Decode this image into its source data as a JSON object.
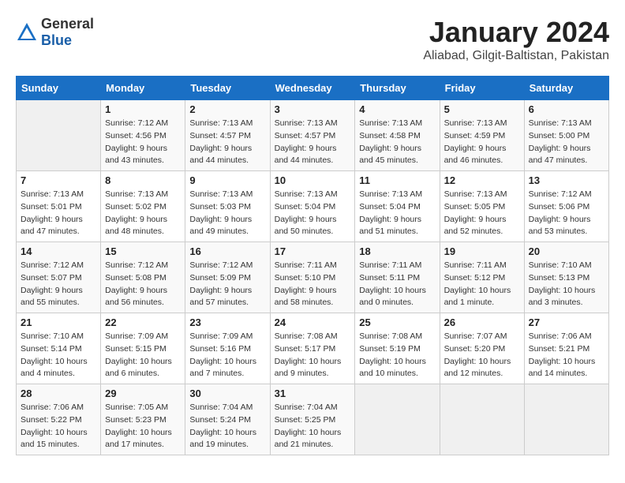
{
  "header": {
    "logo_general": "General",
    "logo_blue": "Blue",
    "title": "January 2024",
    "location": "Aliabad, Gilgit-Baltistan, Pakistan"
  },
  "days_of_week": [
    "Sunday",
    "Monday",
    "Tuesday",
    "Wednesday",
    "Thursday",
    "Friday",
    "Saturday"
  ],
  "weeks": [
    [
      {
        "day": "",
        "sunrise": "",
        "sunset": "",
        "daylight": ""
      },
      {
        "day": "1",
        "sunrise": "Sunrise: 7:12 AM",
        "sunset": "Sunset: 4:56 PM",
        "daylight": "Daylight: 9 hours and 43 minutes."
      },
      {
        "day": "2",
        "sunrise": "Sunrise: 7:13 AM",
        "sunset": "Sunset: 4:57 PM",
        "daylight": "Daylight: 9 hours and 44 minutes."
      },
      {
        "day": "3",
        "sunrise": "Sunrise: 7:13 AM",
        "sunset": "Sunset: 4:57 PM",
        "daylight": "Daylight: 9 hours and 44 minutes."
      },
      {
        "day": "4",
        "sunrise": "Sunrise: 7:13 AM",
        "sunset": "Sunset: 4:58 PM",
        "daylight": "Daylight: 9 hours and 45 minutes."
      },
      {
        "day": "5",
        "sunrise": "Sunrise: 7:13 AM",
        "sunset": "Sunset: 4:59 PM",
        "daylight": "Daylight: 9 hours and 46 minutes."
      },
      {
        "day": "6",
        "sunrise": "Sunrise: 7:13 AM",
        "sunset": "Sunset: 5:00 PM",
        "daylight": "Daylight: 9 hours and 47 minutes."
      }
    ],
    [
      {
        "day": "7",
        "sunrise": "Sunrise: 7:13 AM",
        "sunset": "Sunset: 5:01 PM",
        "daylight": "Daylight: 9 hours and 47 minutes."
      },
      {
        "day": "8",
        "sunrise": "Sunrise: 7:13 AM",
        "sunset": "Sunset: 5:02 PM",
        "daylight": "Daylight: 9 hours and 48 minutes."
      },
      {
        "day": "9",
        "sunrise": "Sunrise: 7:13 AM",
        "sunset": "Sunset: 5:03 PM",
        "daylight": "Daylight: 9 hours and 49 minutes."
      },
      {
        "day": "10",
        "sunrise": "Sunrise: 7:13 AM",
        "sunset": "Sunset: 5:04 PM",
        "daylight": "Daylight: 9 hours and 50 minutes."
      },
      {
        "day": "11",
        "sunrise": "Sunrise: 7:13 AM",
        "sunset": "Sunset: 5:04 PM",
        "daylight": "Daylight: 9 hours and 51 minutes."
      },
      {
        "day": "12",
        "sunrise": "Sunrise: 7:13 AM",
        "sunset": "Sunset: 5:05 PM",
        "daylight": "Daylight: 9 hours and 52 minutes."
      },
      {
        "day": "13",
        "sunrise": "Sunrise: 7:12 AM",
        "sunset": "Sunset: 5:06 PM",
        "daylight": "Daylight: 9 hours and 53 minutes."
      }
    ],
    [
      {
        "day": "14",
        "sunrise": "Sunrise: 7:12 AM",
        "sunset": "Sunset: 5:07 PM",
        "daylight": "Daylight: 9 hours and 55 minutes."
      },
      {
        "day": "15",
        "sunrise": "Sunrise: 7:12 AM",
        "sunset": "Sunset: 5:08 PM",
        "daylight": "Daylight: 9 hours and 56 minutes."
      },
      {
        "day": "16",
        "sunrise": "Sunrise: 7:12 AM",
        "sunset": "Sunset: 5:09 PM",
        "daylight": "Daylight: 9 hours and 57 minutes."
      },
      {
        "day": "17",
        "sunrise": "Sunrise: 7:11 AM",
        "sunset": "Sunset: 5:10 PM",
        "daylight": "Daylight: 9 hours and 58 minutes."
      },
      {
        "day": "18",
        "sunrise": "Sunrise: 7:11 AM",
        "sunset": "Sunset: 5:11 PM",
        "daylight": "Daylight: 10 hours and 0 minutes."
      },
      {
        "day": "19",
        "sunrise": "Sunrise: 7:11 AM",
        "sunset": "Sunset: 5:12 PM",
        "daylight": "Daylight: 10 hours and 1 minute."
      },
      {
        "day": "20",
        "sunrise": "Sunrise: 7:10 AM",
        "sunset": "Sunset: 5:13 PM",
        "daylight": "Daylight: 10 hours and 3 minutes."
      }
    ],
    [
      {
        "day": "21",
        "sunrise": "Sunrise: 7:10 AM",
        "sunset": "Sunset: 5:14 PM",
        "daylight": "Daylight: 10 hours and 4 minutes."
      },
      {
        "day": "22",
        "sunrise": "Sunrise: 7:09 AM",
        "sunset": "Sunset: 5:15 PM",
        "daylight": "Daylight: 10 hours and 6 minutes."
      },
      {
        "day": "23",
        "sunrise": "Sunrise: 7:09 AM",
        "sunset": "Sunset: 5:16 PM",
        "daylight": "Daylight: 10 hours and 7 minutes."
      },
      {
        "day": "24",
        "sunrise": "Sunrise: 7:08 AM",
        "sunset": "Sunset: 5:17 PM",
        "daylight": "Daylight: 10 hours and 9 minutes."
      },
      {
        "day": "25",
        "sunrise": "Sunrise: 7:08 AM",
        "sunset": "Sunset: 5:19 PM",
        "daylight": "Daylight: 10 hours and 10 minutes."
      },
      {
        "day": "26",
        "sunrise": "Sunrise: 7:07 AM",
        "sunset": "Sunset: 5:20 PM",
        "daylight": "Daylight: 10 hours and 12 minutes."
      },
      {
        "day": "27",
        "sunrise": "Sunrise: 7:06 AM",
        "sunset": "Sunset: 5:21 PM",
        "daylight": "Daylight: 10 hours and 14 minutes."
      }
    ],
    [
      {
        "day": "28",
        "sunrise": "Sunrise: 7:06 AM",
        "sunset": "Sunset: 5:22 PM",
        "daylight": "Daylight: 10 hours and 15 minutes."
      },
      {
        "day": "29",
        "sunrise": "Sunrise: 7:05 AM",
        "sunset": "Sunset: 5:23 PM",
        "daylight": "Daylight: 10 hours and 17 minutes."
      },
      {
        "day": "30",
        "sunrise": "Sunrise: 7:04 AM",
        "sunset": "Sunset: 5:24 PM",
        "daylight": "Daylight: 10 hours and 19 minutes."
      },
      {
        "day": "31",
        "sunrise": "Sunrise: 7:04 AM",
        "sunset": "Sunset: 5:25 PM",
        "daylight": "Daylight: 10 hours and 21 minutes."
      },
      {
        "day": "",
        "sunrise": "",
        "sunset": "",
        "daylight": ""
      },
      {
        "day": "",
        "sunrise": "",
        "sunset": "",
        "daylight": ""
      },
      {
        "day": "",
        "sunrise": "",
        "sunset": "",
        "daylight": ""
      }
    ]
  ]
}
